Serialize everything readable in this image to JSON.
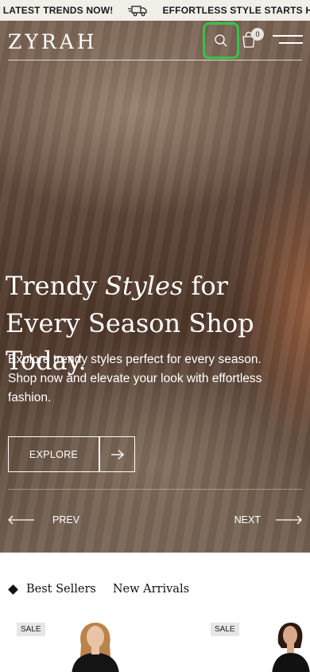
{
  "marquee": {
    "items": [
      "E LATEST TRENDS NOW!",
      "EFFORTLESS STYLE STARTS HERE. B"
    ],
    "icon": "delivery-truck-icon"
  },
  "header": {
    "logo": "ZYRAH",
    "cart_count": "0",
    "icons": [
      "search-icon",
      "shopping-bag-icon",
      "menu-icon"
    ]
  },
  "hero": {
    "title_before": "Trendy ",
    "title_italic": "Styles",
    "title_after": " for Every Season Shop Today.",
    "description": "Explore trendy styles perfect for every season. Shop now and elevate your look with effortless fashion.",
    "explore_label": "EXPLORE",
    "prev_label": "PREV",
    "next_label": "NEXT"
  },
  "tabs": {
    "best_sellers": "Best Sellers",
    "new_arrivals": "New Arrivals"
  },
  "products": [
    {
      "badge": "SALE"
    },
    {
      "badge": "SALE"
    }
  ],
  "colors": {
    "search_highlight": "#34c24a",
    "marquee_bg": "#f2efe9"
  }
}
